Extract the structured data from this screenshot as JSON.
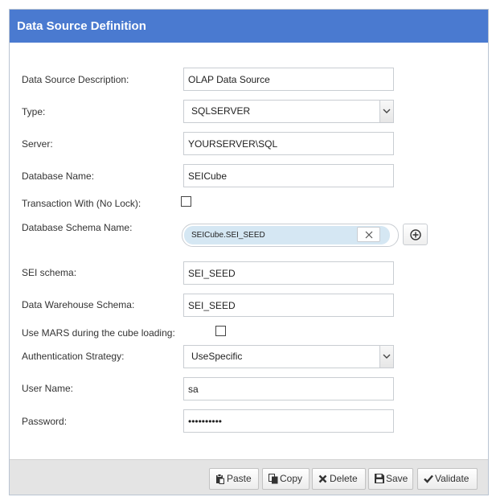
{
  "dialog": {
    "title": "Data Source Definition"
  },
  "form": {
    "description": {
      "label": "Data Source Description:",
      "value": "OLAP Data Source"
    },
    "type": {
      "label": "Type:",
      "value": "SQLSERVER"
    },
    "server": {
      "label": "Server:",
      "value": "YOURSERVER\\SQL"
    },
    "database_name": {
      "label": "Database Name:",
      "value": "SEICube"
    },
    "transaction_no_lock": {
      "label": "Transaction With (No Lock):",
      "checked": false
    },
    "database_schema": {
      "label": "Database Schema Name:",
      "tags": [
        "SEICube.SEI_SEED"
      ]
    },
    "sei_schema": {
      "label": "SEI schema:",
      "value": "SEI_SEED"
    },
    "warehouse_schema": {
      "label": "Data Warehouse Schema:",
      "value": "SEI_SEED"
    },
    "use_mars": {
      "label": "Use MARS during the cube loading:",
      "checked": false
    },
    "auth_strategy": {
      "label": "Authentication Strategy:",
      "value": "UseSpecific"
    },
    "user_name": {
      "label": "User Name:",
      "value": "sa"
    },
    "password": {
      "label": "Password:",
      "value": "sapassword"
    }
  },
  "toolbar": {
    "paste_label": "Paste",
    "copy_label": "Copy",
    "delete_label": "Delete",
    "save_label": "Save",
    "validate_label": "Validate"
  },
  "icons": {
    "remove_tag": "close-icon",
    "add": "plus-circle-icon",
    "paste": "clipboard-icon",
    "copy": "copy-icon",
    "delete": "x-icon",
    "save": "floppy-disk-icon",
    "validate": "checkmark-icon",
    "dropdown": "chevron-down-icon"
  },
  "colors": {
    "title_bar": "#4a7ad0",
    "tag_background": "#d5e7f3",
    "footer": "#e4e4e4"
  }
}
